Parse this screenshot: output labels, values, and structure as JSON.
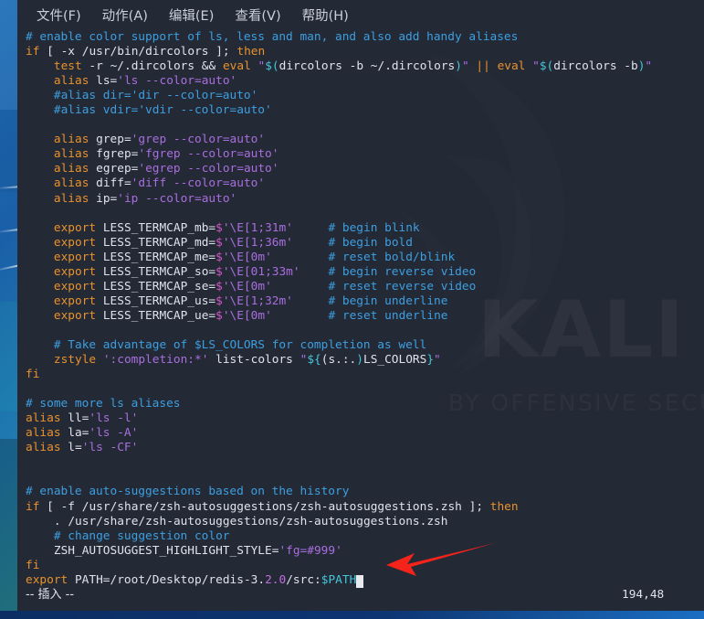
{
  "window": {
    "app": "terminal-vim",
    "background_color": "#242936",
    "desktop_accent": "#1e6fb8"
  },
  "menubar": {
    "items": [
      {
        "name": "file",
        "label": "文件(F)"
      },
      {
        "name": "actions",
        "label": "动作(A)"
      },
      {
        "name": "edit",
        "label": "编辑(E)"
      },
      {
        "name": "view",
        "label": "查看(V)"
      },
      {
        "name": "help",
        "label": "帮助(H)"
      }
    ]
  },
  "watermark": {
    "title": "KALI",
    "subtitle": "BY OFFENSIVE SECURITY"
  },
  "editor": {
    "file_type": "zshrc",
    "mode_label": "-- 插入 --",
    "ruler": "194,48",
    "cursor_color": "#e8eaf0",
    "lines": [
      {
        "i": 0,
        "text": "# enable color support of ls, less and man, and also add handy aliases"
      },
      {
        "i": 1,
        "text": "if [ -x /usr/bin/dircolors ]; then"
      },
      {
        "i": 2,
        "text": "    test -r ~/.dircolors && eval \"$(dircolors -b ~/.dircolors)\" || eval \"$(dircolors -b)\""
      },
      {
        "i": 3,
        "text": "    alias ls='ls --color=auto'"
      },
      {
        "i": 4,
        "text": "    #alias dir='dir --color=auto'"
      },
      {
        "i": 5,
        "text": "    #alias vdir='vdir --color=auto'"
      },
      {
        "i": 6,
        "text": ""
      },
      {
        "i": 7,
        "text": "    alias grep='grep --color=auto'"
      },
      {
        "i": 8,
        "text": "    alias fgrep='fgrep --color=auto'"
      },
      {
        "i": 9,
        "text": "    alias egrep='egrep --color=auto'"
      },
      {
        "i": 10,
        "text": "    alias diff='diff --color=auto'"
      },
      {
        "i": 11,
        "text": "    alias ip='ip --color=auto'"
      },
      {
        "i": 12,
        "text": ""
      },
      {
        "i": 13,
        "text": "    export LESS_TERMCAP_mb=$'\\E[1;31m'     # begin blink"
      },
      {
        "i": 14,
        "text": "    export LESS_TERMCAP_md=$'\\E[1;36m'     # begin bold"
      },
      {
        "i": 15,
        "text": "    export LESS_TERMCAP_me=$'\\E[0m'        # reset bold/blink"
      },
      {
        "i": 16,
        "text": "    export LESS_TERMCAP_so=$'\\E[01;33m'    # begin reverse video"
      },
      {
        "i": 17,
        "text": "    export LESS_TERMCAP_se=$'\\E[0m'        # reset reverse video"
      },
      {
        "i": 18,
        "text": "    export LESS_TERMCAP_us=$'\\E[1;32m'     # begin underline"
      },
      {
        "i": 19,
        "text": "    export LESS_TERMCAP_ue=$'\\E[0m'        # reset underline"
      },
      {
        "i": 20,
        "text": ""
      },
      {
        "i": 21,
        "text": "    # Take advantage of $LS_COLORS for completion as well"
      },
      {
        "i": 22,
        "text": "    zstyle ':completion:*' list-colors \"${(s.:.)LS_COLORS}\""
      },
      {
        "i": 23,
        "text": "fi"
      },
      {
        "i": 24,
        "text": ""
      },
      {
        "i": 25,
        "text": "# some more ls aliases"
      },
      {
        "i": 26,
        "text": "alias ll='ls -l'"
      },
      {
        "i": 27,
        "text": "alias la='ls -A'"
      },
      {
        "i": 28,
        "text": "alias l='ls -CF'"
      },
      {
        "i": 29,
        "text": ""
      },
      {
        "i": 30,
        "text": ""
      },
      {
        "i": 31,
        "text": "# enable auto-suggestions based on the history"
      },
      {
        "i": 32,
        "text": "if [ -f /usr/share/zsh-autosuggestions/zsh-autosuggestions.zsh ]; then"
      },
      {
        "i": 33,
        "text": "    . /usr/share/zsh-autosuggestions/zsh-autosuggestions.zsh"
      },
      {
        "i": 34,
        "text": "    # change suggestion color"
      },
      {
        "i": 35,
        "text": "    ZSH_AUTOSUGGEST_HIGHLIGHT_STYLE='fg=#999'"
      },
      {
        "i": 36,
        "text": "fi"
      },
      {
        "i": 37,
        "text": "export PATH=/root/Desktop/redis-3.2.0/src:$PATH"
      }
    ]
  },
  "annotation": {
    "arrow_color": "#f5241b",
    "points_to": "cursor-at-end-of-path-export-line"
  }
}
